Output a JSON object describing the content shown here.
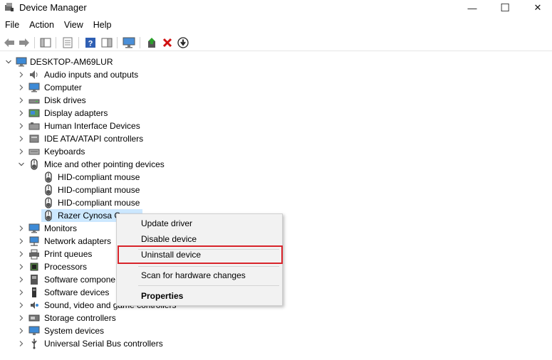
{
  "window": {
    "title": "Device Manager",
    "minimize_glyph": "—",
    "maximize_glyph": "☐",
    "close_glyph": "✕"
  },
  "menu": [
    "File",
    "Action",
    "View",
    "Help"
  ],
  "tree": {
    "root": "DESKTOP-AM69LUR",
    "categories": [
      {
        "label": "Audio inputs and outputs",
        "icon": "speaker-icon"
      },
      {
        "label": "Computer",
        "icon": "monitor-icon"
      },
      {
        "label": "Disk drives",
        "icon": "disk-drive-icon"
      },
      {
        "label": "Display adapters",
        "icon": "display-adapter-icon"
      },
      {
        "label": "Human Interface Devices",
        "icon": "hid-icon"
      },
      {
        "label": "IDE ATA/ATAPI controllers",
        "icon": "ide-controller-icon"
      },
      {
        "label": "Keyboards",
        "icon": "keyboard-icon"
      },
      {
        "label": "Mice and other pointing devices",
        "icon": "mouse-icon"
      },
      {
        "label": "Monitors",
        "icon": "monitor-icon"
      },
      {
        "label": "Network adapters",
        "icon": "network-icon"
      },
      {
        "label": "Print queues",
        "icon": "printer-icon"
      },
      {
        "label": "Processors",
        "icon": "processor-icon"
      },
      {
        "label": "Software compone",
        "icon": "software-component-icon"
      },
      {
        "label": "Software devices",
        "icon": "software-device-icon"
      },
      {
        "label": "Sound, video and game controllers",
        "icon": "sound-icon"
      },
      {
        "label": "Storage controllers",
        "icon": "storage-icon"
      },
      {
        "label": "System devices",
        "icon": "system-icon"
      },
      {
        "label": "Universal Serial Bus controllers",
        "icon": "usb-icon"
      }
    ],
    "mice_children": [
      "HID-compliant mouse",
      "HID-compliant mouse",
      "HID-compliant mouse",
      "Razer Cynosa C"
    ]
  },
  "context_menu": {
    "items": [
      "Update driver",
      "Disable device",
      "Uninstall device",
      "Scan for hardware changes",
      "Properties"
    ]
  },
  "colors": {
    "selection": "#cce8ff",
    "highlight_border": "#d8232a"
  }
}
